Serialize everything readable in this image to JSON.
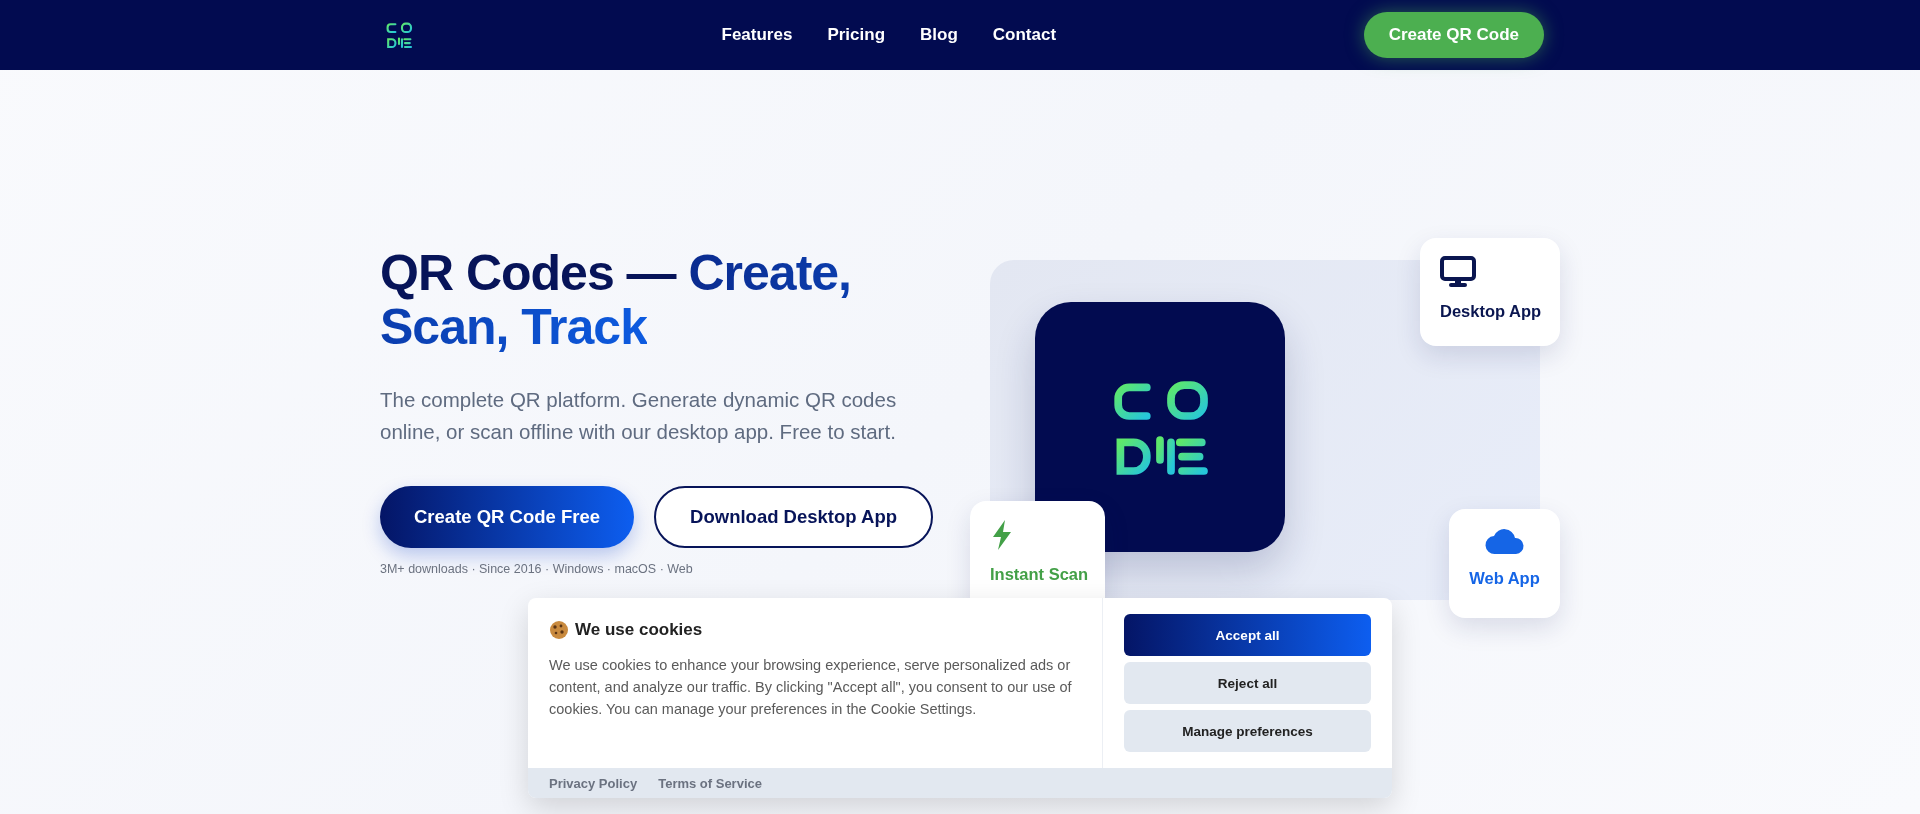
{
  "nav": {
    "links": [
      {
        "label": "Features"
      },
      {
        "label": "Pricing"
      },
      {
        "label": "Blog"
      },
      {
        "label": "Contact"
      }
    ],
    "cta": "Create QR Code"
  },
  "hero": {
    "title": [
      {
        "text": "QR Codes — ",
        "kind": "plain"
      },
      {
        "text": "Create, Scan, Track",
        "kind": "accent"
      }
    ],
    "subtitle": "The complete QR platform. Generate dynamic QR codes online, or scan offline with our desktop app. Free to start.",
    "buttons": [
      {
        "label": "Create QR Code Free",
        "kind": "primary"
      },
      {
        "label": "Download Desktop App",
        "kind": "outline"
      }
    ],
    "meta": "3M+ downloads · Since 2016 · Windows · macOS · Web"
  },
  "illustration": {
    "cards": [
      {
        "label": "Desktop App",
        "kind": "desktop",
        "color": "#0a1650"
      },
      {
        "label": "Instant Scan",
        "kind": "scan",
        "color": "#43a047"
      },
      {
        "label": "Web App",
        "kind": "web",
        "color": "#1565e6"
      }
    ]
  },
  "cookie_banner": {
    "title": "We use cookies",
    "text": "We use cookies to enhance your browsing experience, serve personalized ads or content, and analyze our traffic. By clicking \"Accept all\", you consent to our use of cookies. You can manage your preferences in the Cookie Settings.",
    "buttons": [
      {
        "label": "Accept all",
        "kind": "primary"
      },
      {
        "label": "Reject all",
        "kind": "secondary"
      },
      {
        "label": "Manage preferences",
        "kind": "secondary"
      }
    ],
    "links": [
      {
        "label": "Privacy Policy"
      },
      {
        "label": "Terms of Service"
      }
    ]
  }
}
